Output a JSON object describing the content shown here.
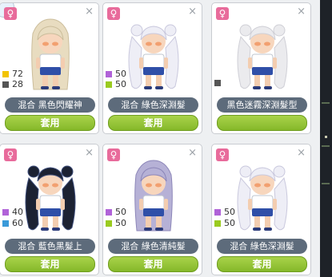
{
  "colors": {
    "pink": "#e86b9b",
    "green": "#95c53a",
    "name_bg": "#5d6b7b"
  },
  "cards": [
    {
      "gender": "♀",
      "close": "×",
      "name": "混合 黑色閃耀神",
      "equip": "套用",
      "stats": [
        {
          "color": "#f2c400",
          "value": "72"
        },
        {
          "color": "#555555",
          "value": "28"
        }
      ],
      "hair": "#e8dcc0",
      "hair_dark": "#cbbd9b"
    },
    {
      "gender": "♀",
      "close": "×",
      "name": "混合 綠色深淵髮",
      "equip": "套用",
      "stats": [
        {
          "color": "#b062d8",
          "value": "50"
        },
        {
          "color": "#9acb1f",
          "value": "50"
        }
      ],
      "hair": "#eeeef6",
      "hair_dark": "#c9c8dd"
    },
    {
      "gender": "♀",
      "close": "×",
      "name": "黑色迷霧深淵髮型",
      "equip": "",
      "stats": [
        {
          "color": "#555555",
          "value": ""
        }
      ],
      "hair": "#ebebee",
      "hair_dark": "#cfcfd6"
    },
    {
      "gender": "♀",
      "close": "×",
      "name": "混合 藍色黑髮上",
      "equip": "套用",
      "stats": [
        {
          "color": "#b062d8",
          "value": "40"
        },
        {
          "color": "#3a9ad9",
          "value": "60"
        }
      ],
      "hair": "#1c2233",
      "hair_dark": "#3d4d7a"
    },
    {
      "gender": "♀",
      "close": "×",
      "name": "混合 綠色清純髮",
      "equip": "套用",
      "stats": [
        {
          "color": "#b062d8",
          "value": "50"
        },
        {
          "color": "#9acb1f",
          "value": "50"
        }
      ],
      "hair": "#b6b1d6",
      "hair_dark": "#8c86b8"
    },
    {
      "gender": "♀",
      "close": "×",
      "name": "混合 綠色深淵髮",
      "equip": "套用",
      "stats": [
        {
          "color": "#b062d8",
          "value": "50"
        },
        {
          "color": "#9acb1f",
          "value": "50"
        }
      ],
      "hair": "#eeeef6",
      "hair_dark": "#c9c8dd"
    }
  ]
}
